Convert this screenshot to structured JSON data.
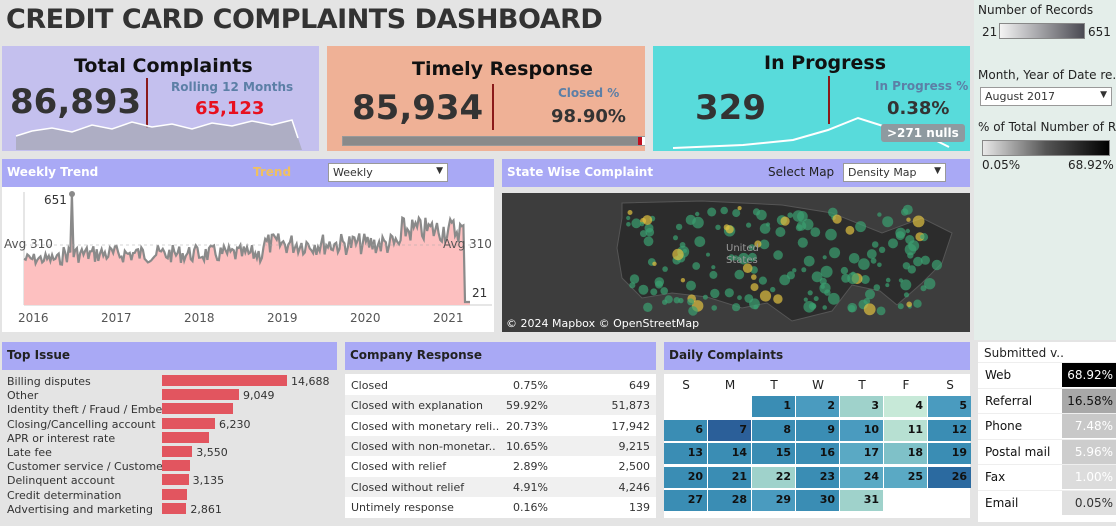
{
  "title": "CREDIT CARD COMPLAINTS DASHBOARD",
  "kpi": {
    "total": {
      "title": "Total Complaints",
      "value": "86,893",
      "sub_label": "Rolling 12 Months",
      "sub_value": "65,123"
    },
    "timely": {
      "title": "Timely Response",
      "value": "85,934",
      "sub_label": "Closed %",
      "sub_value": "98.90%",
      "progress": 0.989
    },
    "progress": {
      "title": "In Progress",
      "value": "329",
      "sub_label": "In Progress %",
      "sub_value": "0.38%",
      "nulls": ">271 nulls"
    }
  },
  "weekly": {
    "header": "Weekly Trend",
    "trend_label": "Trend",
    "dropdown": "Weekly",
    "peak": "651",
    "min": "21",
    "avg_left": "Avg 310",
    "avg_right": "Avg 310",
    "years": [
      "2016",
      "2017",
      "2018",
      "2019",
      "2020",
      "2021"
    ]
  },
  "map": {
    "header": "State Wise Complaint",
    "select_label": "Select Map",
    "dropdown": "Density Map",
    "country": "United States",
    "attribution": "© 2024 Mapbox © OpenStreetMap"
  },
  "side": {
    "records_title": "Number of Records",
    "records_min": "21",
    "records_max": "651",
    "month_title": "Month, Year of Date re..",
    "month_value": "August 2017",
    "pct_title": "% of Total Number of R..",
    "pct_min": "0.05%",
    "pct_max": "68.92%"
  },
  "issues": {
    "header": "Top Issue",
    "rows": [
      {
        "label": "Billing disputes",
        "value": 14688,
        "text": "14,688"
      },
      {
        "label": "Other",
        "value": 9049,
        "text": "9,049"
      },
      {
        "label": "Identity theft / Fraud / Embe..",
        "value": 8400,
        "text": ""
      },
      {
        "label": "Closing/Cancelling account",
        "value": 6230,
        "text": "6,230"
      },
      {
        "label": "APR or interest rate",
        "value": 5500,
        "text": ""
      },
      {
        "label": "Late fee",
        "value": 3550,
        "text": "3,550"
      },
      {
        "label": "Customer service / Custome..",
        "value": 3300,
        "text": ""
      },
      {
        "label": "Delinquent account",
        "value": 3135,
        "text": "3,135"
      },
      {
        "label": "Credit determination",
        "value": 2950,
        "text": ""
      },
      {
        "label": "Advertising and marketing",
        "value": 2861,
        "text": "2,861"
      }
    ]
  },
  "response": {
    "header": "Company Response",
    "rows": [
      {
        "label": "Closed",
        "pct": "0.75%",
        "count": "649"
      },
      {
        "label": "Closed with explanation",
        "pct": "59.92%",
        "count": "51,873"
      },
      {
        "label": "Closed with monetary reli..",
        "pct": "20.73%",
        "count": "17,942"
      },
      {
        "label": "Closed with non-monetar..",
        "pct": "10.65%",
        "count": "9,215"
      },
      {
        "label": "Closed with relief",
        "pct": "2.89%",
        "count": "2,500"
      },
      {
        "label": "Closed without relief",
        "pct": "4.91%",
        "count": "4,246"
      },
      {
        "label": "Untimely response",
        "pct": "0.16%",
        "count": "139"
      }
    ]
  },
  "daily": {
    "header": "Daily Complaints",
    "weekdays": [
      "S",
      "M",
      "T",
      "W",
      "T",
      "F",
      "S"
    ],
    "days": [
      {
        "d": "1",
        "c": "#3a8db4"
      },
      {
        "d": "2",
        "c": "#4a9bbf"
      },
      {
        "d": "3",
        "c": "#9fd2cb"
      },
      {
        "d": "4",
        "c": "#c7e9d8"
      },
      {
        "d": "5",
        "c": "#4a9bbf"
      },
      {
        "d": "6",
        "c": "#3a8db4"
      },
      {
        "d": "7",
        "c": "#2b5f99"
      },
      {
        "d": "8",
        "c": "#3a8db4"
      },
      {
        "d": "9",
        "c": "#3a8db4"
      },
      {
        "d": "10",
        "c": "#4a9bbf"
      },
      {
        "d": "11",
        "c": "#b7e0d2"
      },
      {
        "d": "12",
        "c": "#3a8db4"
      },
      {
        "d": "13",
        "c": "#3a8db4"
      },
      {
        "d": "14",
        "c": "#3a8db4"
      },
      {
        "d": "15",
        "c": "#3a8db4"
      },
      {
        "d": "16",
        "c": "#3a8db4"
      },
      {
        "d": "17",
        "c": "#5aa9c4"
      },
      {
        "d": "18",
        "c": "#7fc1c8"
      },
      {
        "d": "19",
        "c": "#3a8db4"
      },
      {
        "d": "20",
        "c": "#3a8db4"
      },
      {
        "d": "21",
        "c": "#3a8db4"
      },
      {
        "d": "22",
        "c": "#9fd2cb"
      },
      {
        "d": "23",
        "c": "#3a8db4"
      },
      {
        "d": "24",
        "c": "#5aa9c4"
      },
      {
        "d": "25",
        "c": "#5aa9c4"
      },
      {
        "d": "26",
        "c": "#2b6aa0"
      },
      {
        "d": "27",
        "c": "#3a8db4"
      },
      {
        "d": "28",
        "c": "#3a8db4"
      },
      {
        "d": "29",
        "c": "#4a9bbf"
      },
      {
        "d": "30",
        "c": "#3a8db4"
      },
      {
        "d": "31",
        "c": "#9fd2cb"
      }
    ],
    "first_weekday": 2
  },
  "submitted": {
    "header": "Submitted v..",
    "rows": [
      {
        "label": "Web",
        "pct": "68.92%",
        "bg": "#000000",
        "fg": "#ffffff"
      },
      {
        "label": "Referral",
        "pct": "16.58%",
        "bg": "#a8a8a8",
        "fg": "#111111"
      },
      {
        "label": "Phone",
        "pct": "7.48%",
        "bg": "#c8c8c8",
        "fg": "#ffffff"
      },
      {
        "label": "Postal mail",
        "pct": "5.96%",
        "bg": "#cdcdcd",
        "fg": "#ffffff"
      },
      {
        "label": "Fax",
        "pct": "1.00%",
        "bg": "#dcdcdc",
        "fg": "#ffffff"
      },
      {
        "label": "Email",
        "pct": "0.05%",
        "bg": "#e0e0e0",
        "fg": "#333333"
      }
    ]
  },
  "colors": {
    "bar": "#e2555f",
    "alert": "#e8101e",
    "header": "#a9a9f5"
  }
}
